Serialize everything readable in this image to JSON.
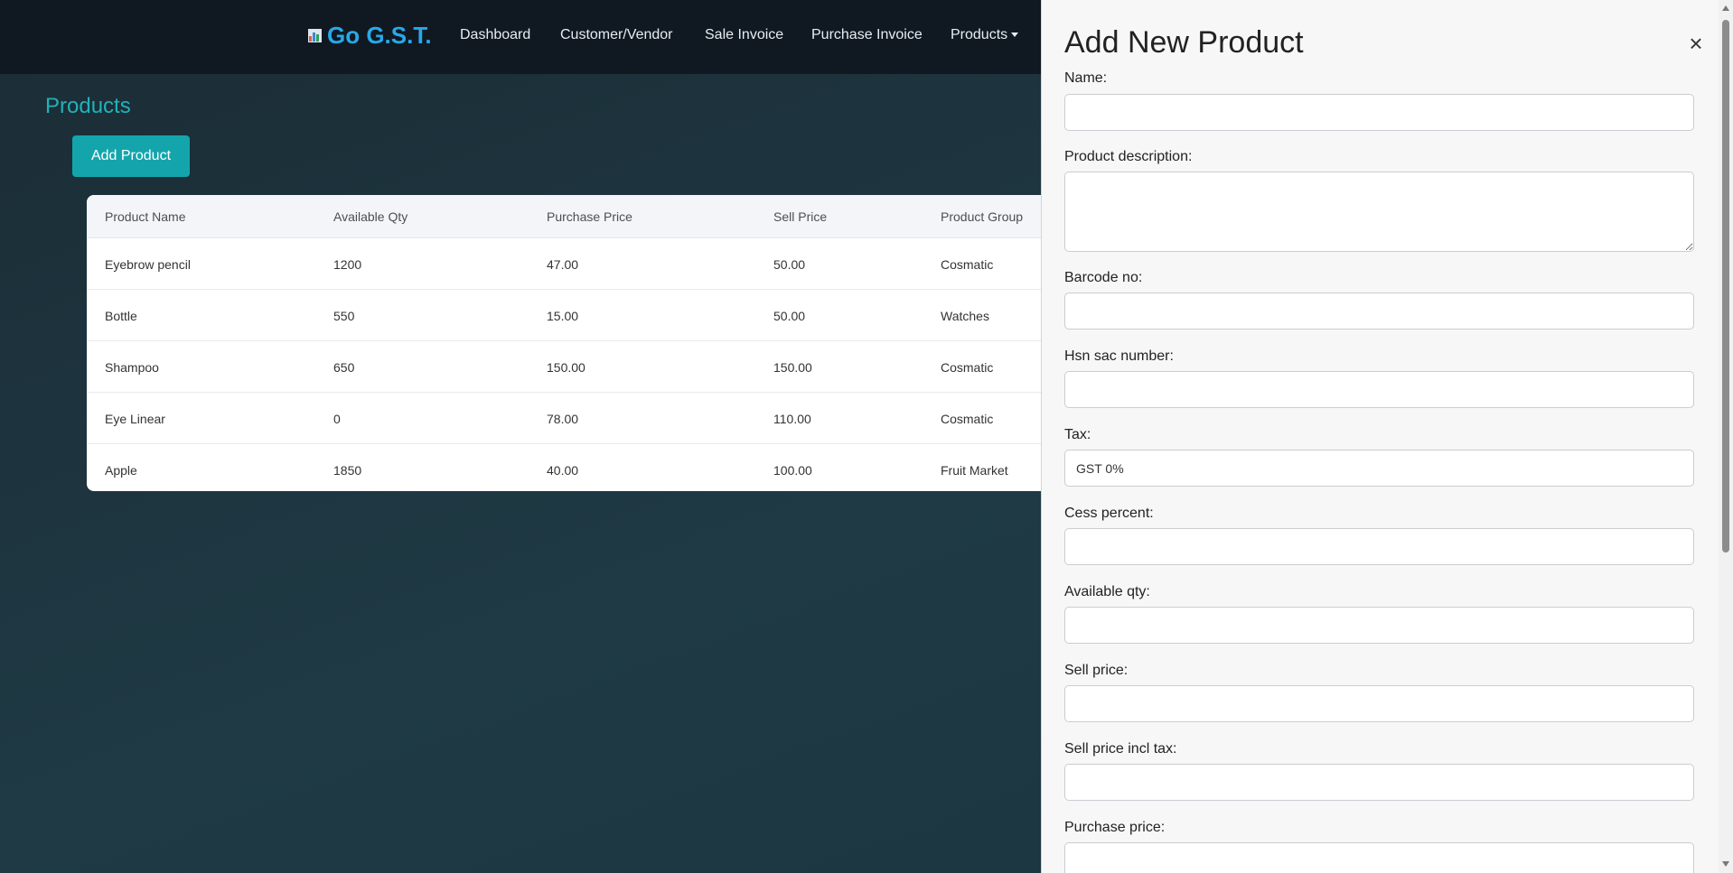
{
  "nav": {
    "brand": "Go G.S.T.",
    "links": [
      "Dashboard",
      "Customer/Vendor",
      "Sale Invoice",
      "Purchase Invoice",
      "Products"
    ]
  },
  "page": {
    "title": "Products",
    "add_button": "Add Product"
  },
  "table": {
    "headers": [
      "Product Name",
      "Available Qty",
      "Purchase Price",
      "Sell Price",
      "Product Group"
    ],
    "rows": [
      [
        "Eyebrow pencil",
        "1200",
        "47.00",
        "50.00",
        "Cosmatic"
      ],
      [
        "Bottle",
        "550",
        "15.00",
        "50.00",
        "Watches"
      ],
      [
        "Shampoo",
        "650",
        "150.00",
        "150.00",
        "Cosmatic"
      ],
      [
        "Eye Linear",
        "0",
        "78.00",
        "110.00",
        "Cosmatic"
      ],
      [
        "Apple",
        "1850",
        "40.00",
        "100.00",
        "Fruit Market"
      ]
    ]
  },
  "panel": {
    "title": "Add New Product",
    "close": "×",
    "fields": {
      "name": {
        "label": "Name:",
        "value": ""
      },
      "description": {
        "label": "Product description:",
        "value": ""
      },
      "barcode": {
        "label": "Barcode no:",
        "value": ""
      },
      "hsn": {
        "label": "Hsn sac number:",
        "value": ""
      },
      "tax": {
        "label": "Tax:",
        "value": "GST 0%"
      },
      "cess": {
        "label": "Cess percent:",
        "value": ""
      },
      "qty": {
        "label": "Available qty:",
        "value": ""
      },
      "sell_price": {
        "label": "Sell price:",
        "value": ""
      },
      "sell_incl_tax": {
        "label": "Sell price incl tax:",
        "value": ""
      },
      "purchase_price": {
        "label": "Purchase price:",
        "value": ""
      }
    }
  },
  "colors": {
    "accent": "#14a5ac",
    "brand": "#2aa7e8",
    "navbar": "#101922"
  }
}
